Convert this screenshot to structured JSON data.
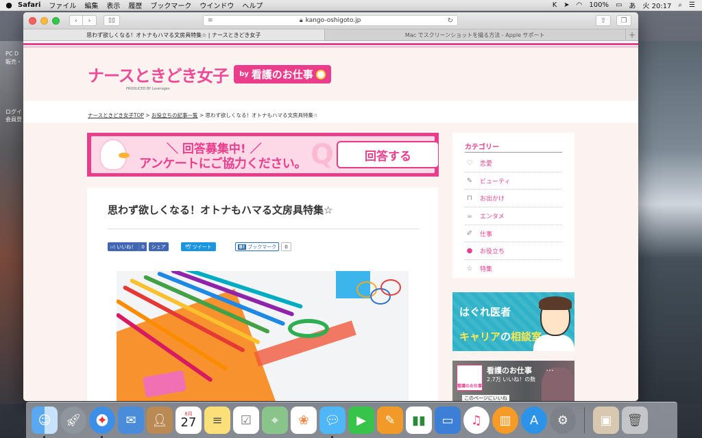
{
  "menubar": {
    "apple": "",
    "app": "Safari",
    "items": [
      "ファイル",
      "編集",
      "表示",
      "履歴",
      "ブックマーク",
      "ウインドウ",
      "ヘルプ"
    ],
    "battery": "100%",
    "input_method": "あ",
    "clock": "火 20:17"
  },
  "desktop": {
    "label1": "PC D",
    "label1b": "販売・",
    "label2": "ログイ",
    "label2b": "会員登"
  },
  "browser": {
    "url": "kango-oshigoto.jp",
    "tabs": [
      {
        "title": "思わず欲しくなる！オトナもハマる文房具特集☆ | ナースときどき女子",
        "active": true
      },
      {
        "title": "Mac でスクリーンショットを撮る方法 - Apple サポート",
        "active": false
      }
    ]
  },
  "site": {
    "logo_main": "ナースときどき女子",
    "logo_by": "by",
    "logo_badge": "看護のお仕事",
    "logo_sub": "PRODUCED BY Leverages",
    "breadcrumb": {
      "home": "ナースときどき女子TOP",
      "sep": " > ",
      "category": "お役立ちの記事一覧",
      "current": "思わず欲しくなる！オトナもハマる文房具特集☆"
    }
  },
  "banner": {
    "line1": "＼ 回答募集中! ／",
    "line2": "アンケートにご協力ください。",
    "cta": "回答する",
    "q": "Q"
  },
  "article": {
    "title": "思わず欲しくなる！オトナもハマる文房具特集☆",
    "fb_like": "いいね！",
    "fb_count": "0",
    "fb_share": "シェア",
    "tweet": "ツイート",
    "hatena_label": "ブックマーク",
    "hatena_b": "B!",
    "hatena_count": "0"
  },
  "sidebar": {
    "heading": "カテゴリー",
    "categories": [
      {
        "label": "恋愛",
        "icon": "love-icon"
      },
      {
        "label": "ビューティ",
        "icon": "beauty-icon"
      },
      {
        "label": "お出かけ",
        "icon": "bag-icon"
      },
      {
        "label": "エンタメ",
        "icon": "cup-icon"
      },
      {
        "label": "仕事",
        "icon": "work-icon"
      },
      {
        "label": "お役立ち",
        "icon": "speech-icon"
      },
      {
        "label": "特集",
        "icon": "star-icon"
      }
    ]
  },
  "ad1": {
    "line1": "はぐれ医者",
    "line2_a": "キャリア",
    "line2_b": "の",
    "line2_c": "相談室"
  },
  "ad2": {
    "name": "看護のお仕事",
    "likes": "2.7万 いいね！の数",
    "logo": "看護のお仕事",
    "dots": "…",
    "bottom": "このページにいいね"
  },
  "dock": {
    "items": [
      "finder",
      "launchpad",
      "safari",
      "mail",
      "contacts",
      "calendar",
      "notes",
      "reminders",
      "maps",
      "photos",
      "messages",
      "facetime",
      "pages",
      "numbers",
      "keynote",
      "itunes",
      "ibooks",
      "app-store",
      "system-preferences",
      "preview",
      "trash"
    ],
    "calendar_month": "8月",
    "calendar_day": "27"
  },
  "colors": {
    "brand_pink": "#ea3e8d",
    "header_bg": "#fbf3f0",
    "fb_blue": "#4267b2",
    "twitter_blue": "#1b95e0",
    "ad_teal": "#2fb2c8"
  }
}
